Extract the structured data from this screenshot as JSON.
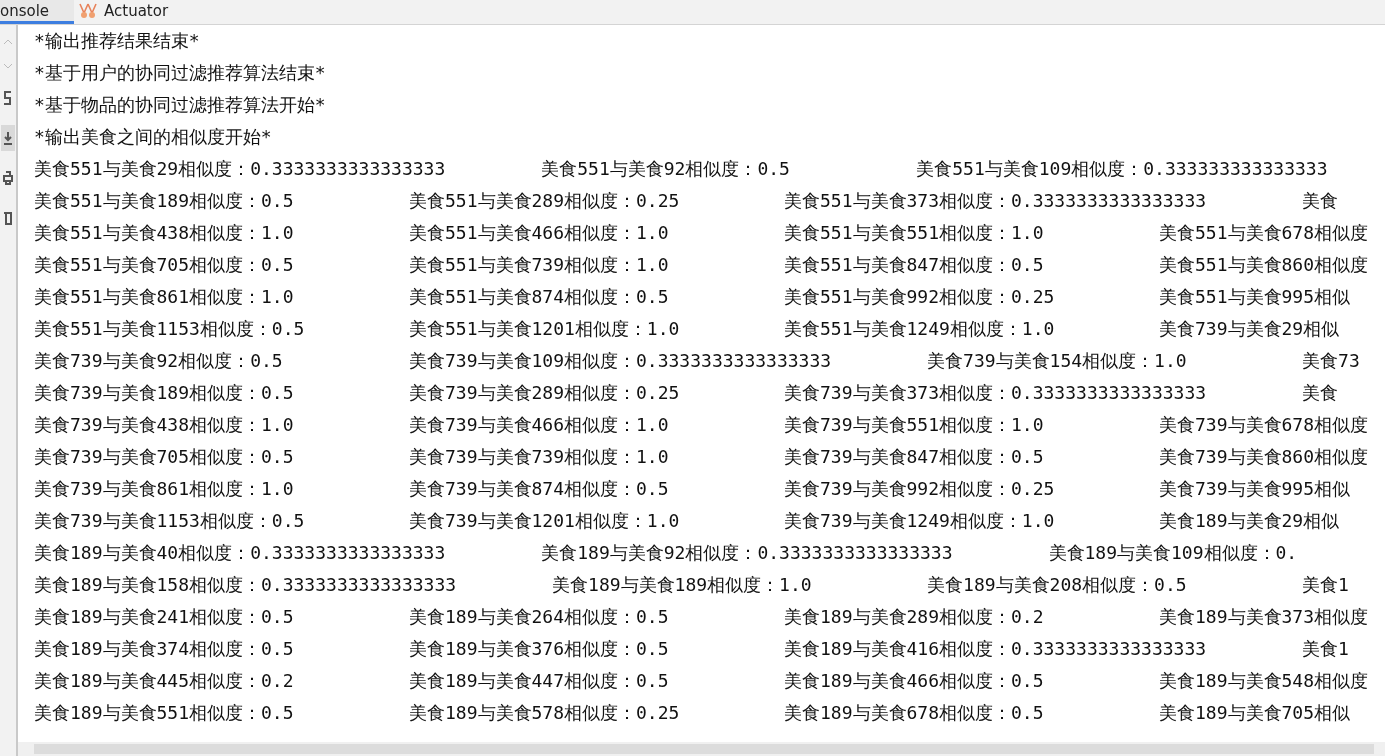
{
  "tabs": [
    {
      "label": "onsole",
      "selected": true
    },
    {
      "label": "Actuator",
      "selected": false
    }
  ],
  "console": {
    "lines": [
      [
        "*输出推荐结果结束*"
      ],
      [
        "*基于用户的协同过滤推荐算法结束*"
      ],
      [
        "*基于物品的协同过滤推荐算法开始*"
      ],
      [
        "*输出美食之间的相似度开始*"
      ],
      [
        "美食551与美食29相似度：0.3333333333333333",
        "美食551与美食92相似度：0.5",
        "美食551与美食109相似度：0.333333333333333"
      ],
      [
        "美食551与美食189相似度：0.5",
        "美食551与美食289相似度：0.25",
        "美食551与美食373相似度：0.3333333333333333",
        "美食"
      ],
      [
        "美食551与美食438相似度：1.0",
        "美食551与美食466相似度：1.0",
        "美食551与美食551相似度：1.0",
        "美食551与美食678相似度"
      ],
      [
        "美食551与美食705相似度：0.5",
        "美食551与美食739相似度：1.0",
        "美食551与美食847相似度：0.5",
        "美食551与美食860相似度"
      ],
      [
        "美食551与美食861相似度：1.0",
        "美食551与美食874相似度：0.5",
        "美食551与美食992相似度：0.25",
        "美食551与美食995相似"
      ],
      [
        "美食551与美食1153相似度：0.5",
        "美食551与美食1201相似度：1.0",
        "美食551与美食1249相似度：1.0",
        "美食739与美食29相似"
      ],
      [
        "美食739与美食92相似度：0.5",
        "美食739与美食109相似度：0.3333333333333333",
        "美食739与美食154相似度：1.0",
        "美食73"
      ],
      [
        "美食739与美食189相似度：0.5",
        "美食739与美食289相似度：0.25",
        "美食739与美食373相似度：0.3333333333333333",
        "美食"
      ],
      [
        "美食739与美食438相似度：1.0",
        "美食739与美食466相似度：1.0",
        "美食739与美食551相似度：1.0",
        "美食739与美食678相似度"
      ],
      [
        "美食739与美食705相似度：0.5",
        "美食739与美食739相似度：1.0",
        "美食739与美食847相似度：0.5",
        "美食739与美食860相似度"
      ],
      [
        "美食739与美食861相似度：1.0",
        "美食739与美食874相似度：0.5",
        "美食739与美食992相似度：0.25",
        "美食739与美食995相似"
      ],
      [
        "美食739与美食1153相似度：0.5",
        "美食739与美食1201相似度：1.0",
        "美食739与美食1249相似度：1.0",
        "美食189与美食29相似"
      ],
      [
        "美食189与美食40相似度：0.3333333333333333",
        "美食189与美食92相似度：0.3333333333333333",
        "美食189与美食109相似度：0."
      ],
      [
        "美食189与美食158相似度：0.3333333333333333",
        "美食189与美食189相似度：1.0",
        "美食189与美食208相似度：0.5",
        "美食1"
      ],
      [
        "美食189与美食241相似度：0.5",
        "美食189与美食264相似度：0.5",
        "美食189与美食289相似度：0.2",
        "美食189与美食373相似度"
      ],
      [
        "美食189与美食374相似度：0.5",
        "美食189与美食376相似度：0.5",
        "美食189与美食416相似度：0.3333333333333333",
        "美食1"
      ],
      [
        "美食189与美食445相似度：0.2",
        "美食189与美食447相似度：0.5",
        "美食189与美食466相似度：0.5",
        "美食189与美食548相似度"
      ],
      [
        "美食189与美食551相似度：0.5",
        "美食189与美食578相似度：0.25",
        "美食189与美食678相似度：0.5",
        "美食189与美食705相似"
      ]
    ]
  }
}
